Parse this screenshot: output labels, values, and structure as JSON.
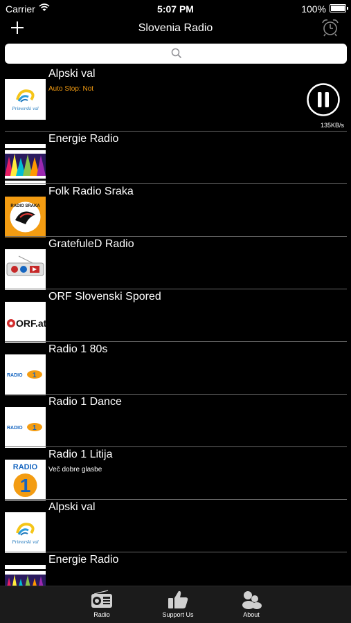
{
  "status": {
    "carrier": "Carrier",
    "time": "5:07 PM",
    "battery": "100%"
  },
  "nav": {
    "title": "Slovenia Radio"
  },
  "player": {
    "rate": "135KB/s"
  },
  "stations": [
    {
      "name": "Alpski val",
      "subtitle": "Auto Stop: Not",
      "logo": "primorski-val-logo",
      "logo_text": "Primorski val"
    },
    {
      "name": "Energie Radio",
      "subtitle": "",
      "logo": "energie-radio-logo",
      "logo_text": ""
    },
    {
      "name": "Folk Radio Sraka",
      "subtitle": "",
      "logo": "folk-radio-sraka-logo",
      "logo_text": "RADIO SRAKA"
    },
    {
      "name": "GratefuleD Radio",
      "subtitle": "",
      "logo": "gratefuled-radio-logo",
      "logo_text": ""
    },
    {
      "name": "ORF Slovenski Spored",
      "subtitle": "",
      "logo": "orf-logo",
      "logo_text": "ORF.at"
    },
    {
      "name": "Radio 1 80s",
      "subtitle": "",
      "logo": "radio-1-logo",
      "logo_text": "RADIO"
    },
    {
      "name": "Radio 1 Dance",
      "subtitle": "",
      "logo": "radio-1-logo",
      "logo_text": "RADIO"
    },
    {
      "name": "Radio 1 Litija",
      "subtitle": "Več dobre glasbe",
      "logo": "radio-1-big-logo",
      "logo_text": "RADIO"
    },
    {
      "name": "Alpski val",
      "subtitle": "",
      "logo": "primorski-val-logo",
      "logo_text": "Primorski val"
    },
    {
      "name": "Energie Radio",
      "subtitle": "",
      "logo": "energie-radio-logo",
      "logo_text": ""
    }
  ],
  "tabs": [
    {
      "label": "Radio",
      "icon": "radio-icon"
    },
    {
      "label": "Support Us",
      "icon": "thumbs-up-icon"
    },
    {
      "label": "About",
      "icon": "about-icon"
    }
  ],
  "colors": {
    "background": "#000000",
    "accent_orange": "#f39c12",
    "separator": "#6a6a6a",
    "tab_bar": "#1b1b1b"
  }
}
